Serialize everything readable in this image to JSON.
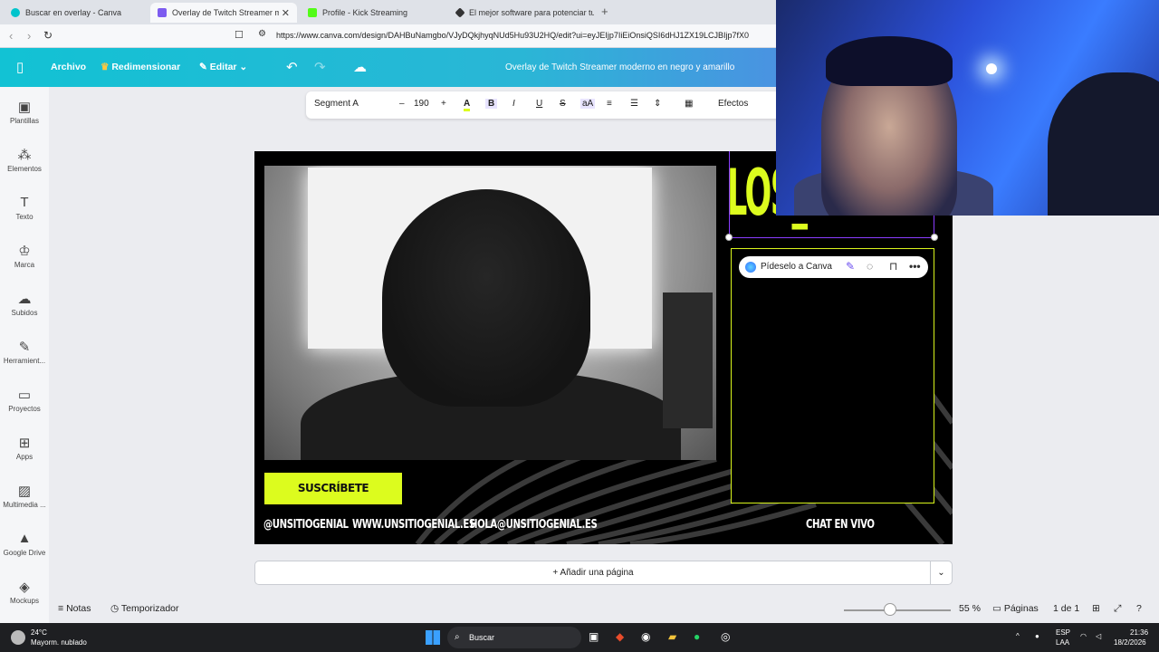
{
  "browser": {
    "tabs": [
      {
        "title": "Buscar en overlay - Canva",
        "active": false
      },
      {
        "title": "Overlay de Twitch Streamer mod",
        "active": true
      },
      {
        "title": "Profile - Kick Streaming",
        "active": false
      },
      {
        "title": "El mejor software para potenciar tu st",
        "active": false
      }
    ],
    "url": "https://www.canva.com/design/DAHBuNamgbo/VJyDQkjhyqNUd5Hu93U2HQ/edit?ui=eyJEIjp7IiEiOnsiQSI6dHJ1ZX19LCJBIjp7fX0"
  },
  "header": {
    "archivo": "Archivo",
    "redimensionar": "Redimensionar",
    "editar": "Editar",
    "design_title": "Overlay de Twitch Streamer moderno en negro y amarillo"
  },
  "rail": [
    {
      "label": "Plantillas",
      "icon": "templates-icon",
      "glyph": "▣"
    },
    {
      "label": "Elementos",
      "icon": "elements-icon",
      "glyph": "⁂"
    },
    {
      "label": "Texto",
      "icon": "text-icon",
      "glyph": "T"
    },
    {
      "label": "Marca",
      "icon": "brand-icon",
      "glyph": "♔"
    },
    {
      "label": "Subidos",
      "icon": "upload-icon",
      "glyph": "☁"
    },
    {
      "label": "Herramient...",
      "icon": "tools-icon",
      "glyph": "✎"
    },
    {
      "label": "Proyectos",
      "icon": "folder-icon",
      "glyph": "▭"
    },
    {
      "label": "Apps",
      "icon": "apps-icon",
      "glyph": "⊞"
    },
    {
      "label": "Multimedia ...",
      "icon": "media-icon",
      "glyph": "▨"
    },
    {
      "label": "Google Drive",
      "icon": "drive-icon",
      "glyph": "▲"
    },
    {
      "label": "Mockups",
      "icon": "mockups-icon",
      "glyph": "◈"
    }
  ],
  "toolbar": {
    "font": "Segment A",
    "minus": "–",
    "size": "190",
    "plus": "+",
    "effects": "Efectos"
  },
  "canvas": {
    "big_text": "LOS_",
    "subscribe": "SUSCRÍBETE",
    "handle": "@UNSITIOGENIAL",
    "website": "WWW.UNSITIOGENIAL.ES",
    "email": "HOLA@UNSITIOGENIAL.ES",
    "chat_label": "CHAT EN VIVO",
    "ai_prompt": "Pídeselo a Canva",
    "accent_color": "#dcfc1e"
  },
  "add_page": "+ Añadir una página",
  "bottom": {
    "notas": "Notas",
    "temporizador": "Temporizador",
    "zoom": "55 %",
    "zoom_fraction": 0.55,
    "paginas": "Páginas",
    "page_count": "1 de 1"
  },
  "taskbar": {
    "temp": "24°C",
    "weather": "Mayorm. nublado",
    "search": "Buscar",
    "lang1": "ESP",
    "lang2": "LAA",
    "time": "21:36",
    "date": "18/2/2026"
  }
}
